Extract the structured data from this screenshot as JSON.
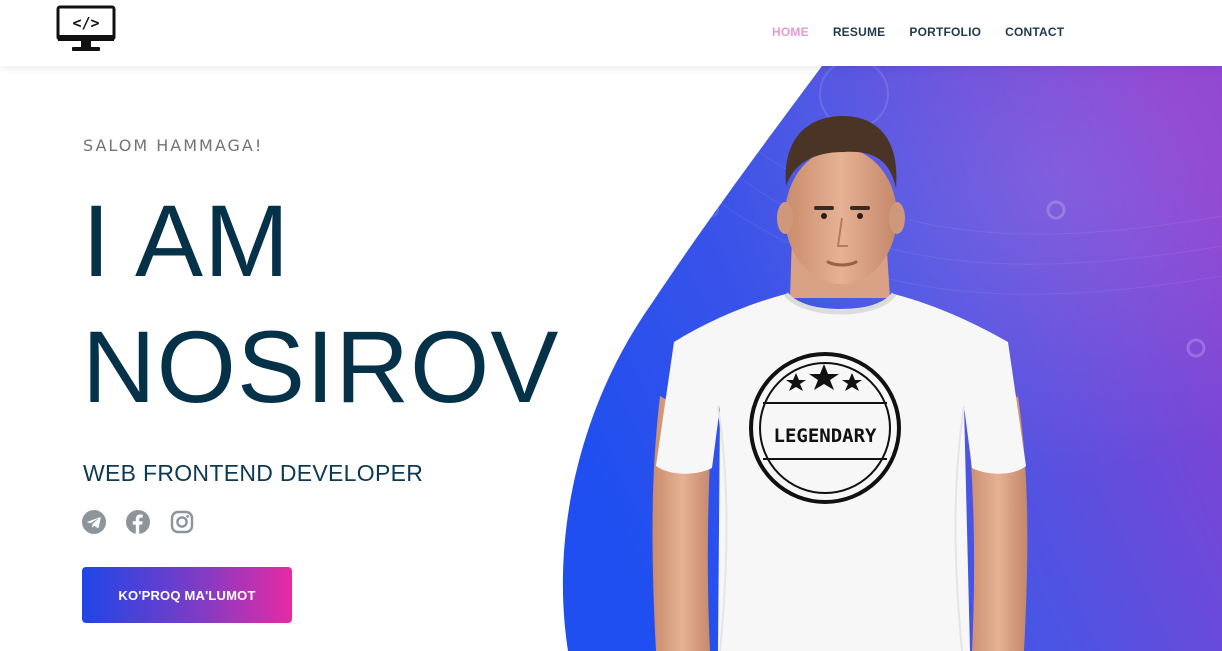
{
  "header": {
    "logo_icon": "code-monitor-icon",
    "logo_text": "</>",
    "nav": [
      {
        "label": "HOME",
        "active": true
      },
      {
        "label": "RESUME",
        "active": false
      },
      {
        "label": "PORTFOLIO",
        "active": false
      },
      {
        "label": "CONTACT",
        "active": false
      }
    ]
  },
  "hero": {
    "greeting": "SALOM HAMMAGA!",
    "title_line1": "I AM",
    "title_line2": "NOSIROV",
    "subtitle": "WEB FRONTEND DEVELOPER",
    "socials": [
      "telegram-icon",
      "facebook-icon",
      "instagram-icon"
    ],
    "cta_label": "KO'PROQ MA'LUMOT",
    "shirt_text": "LEGENDARY"
  },
  "colors": {
    "nav_active": "#e49ad6",
    "title": "#063249",
    "gradient_start": "#1f46e6",
    "gradient_end": "#e62ba4",
    "art_blue": "#2a55e8",
    "art_purple": "#8d3fd0"
  }
}
